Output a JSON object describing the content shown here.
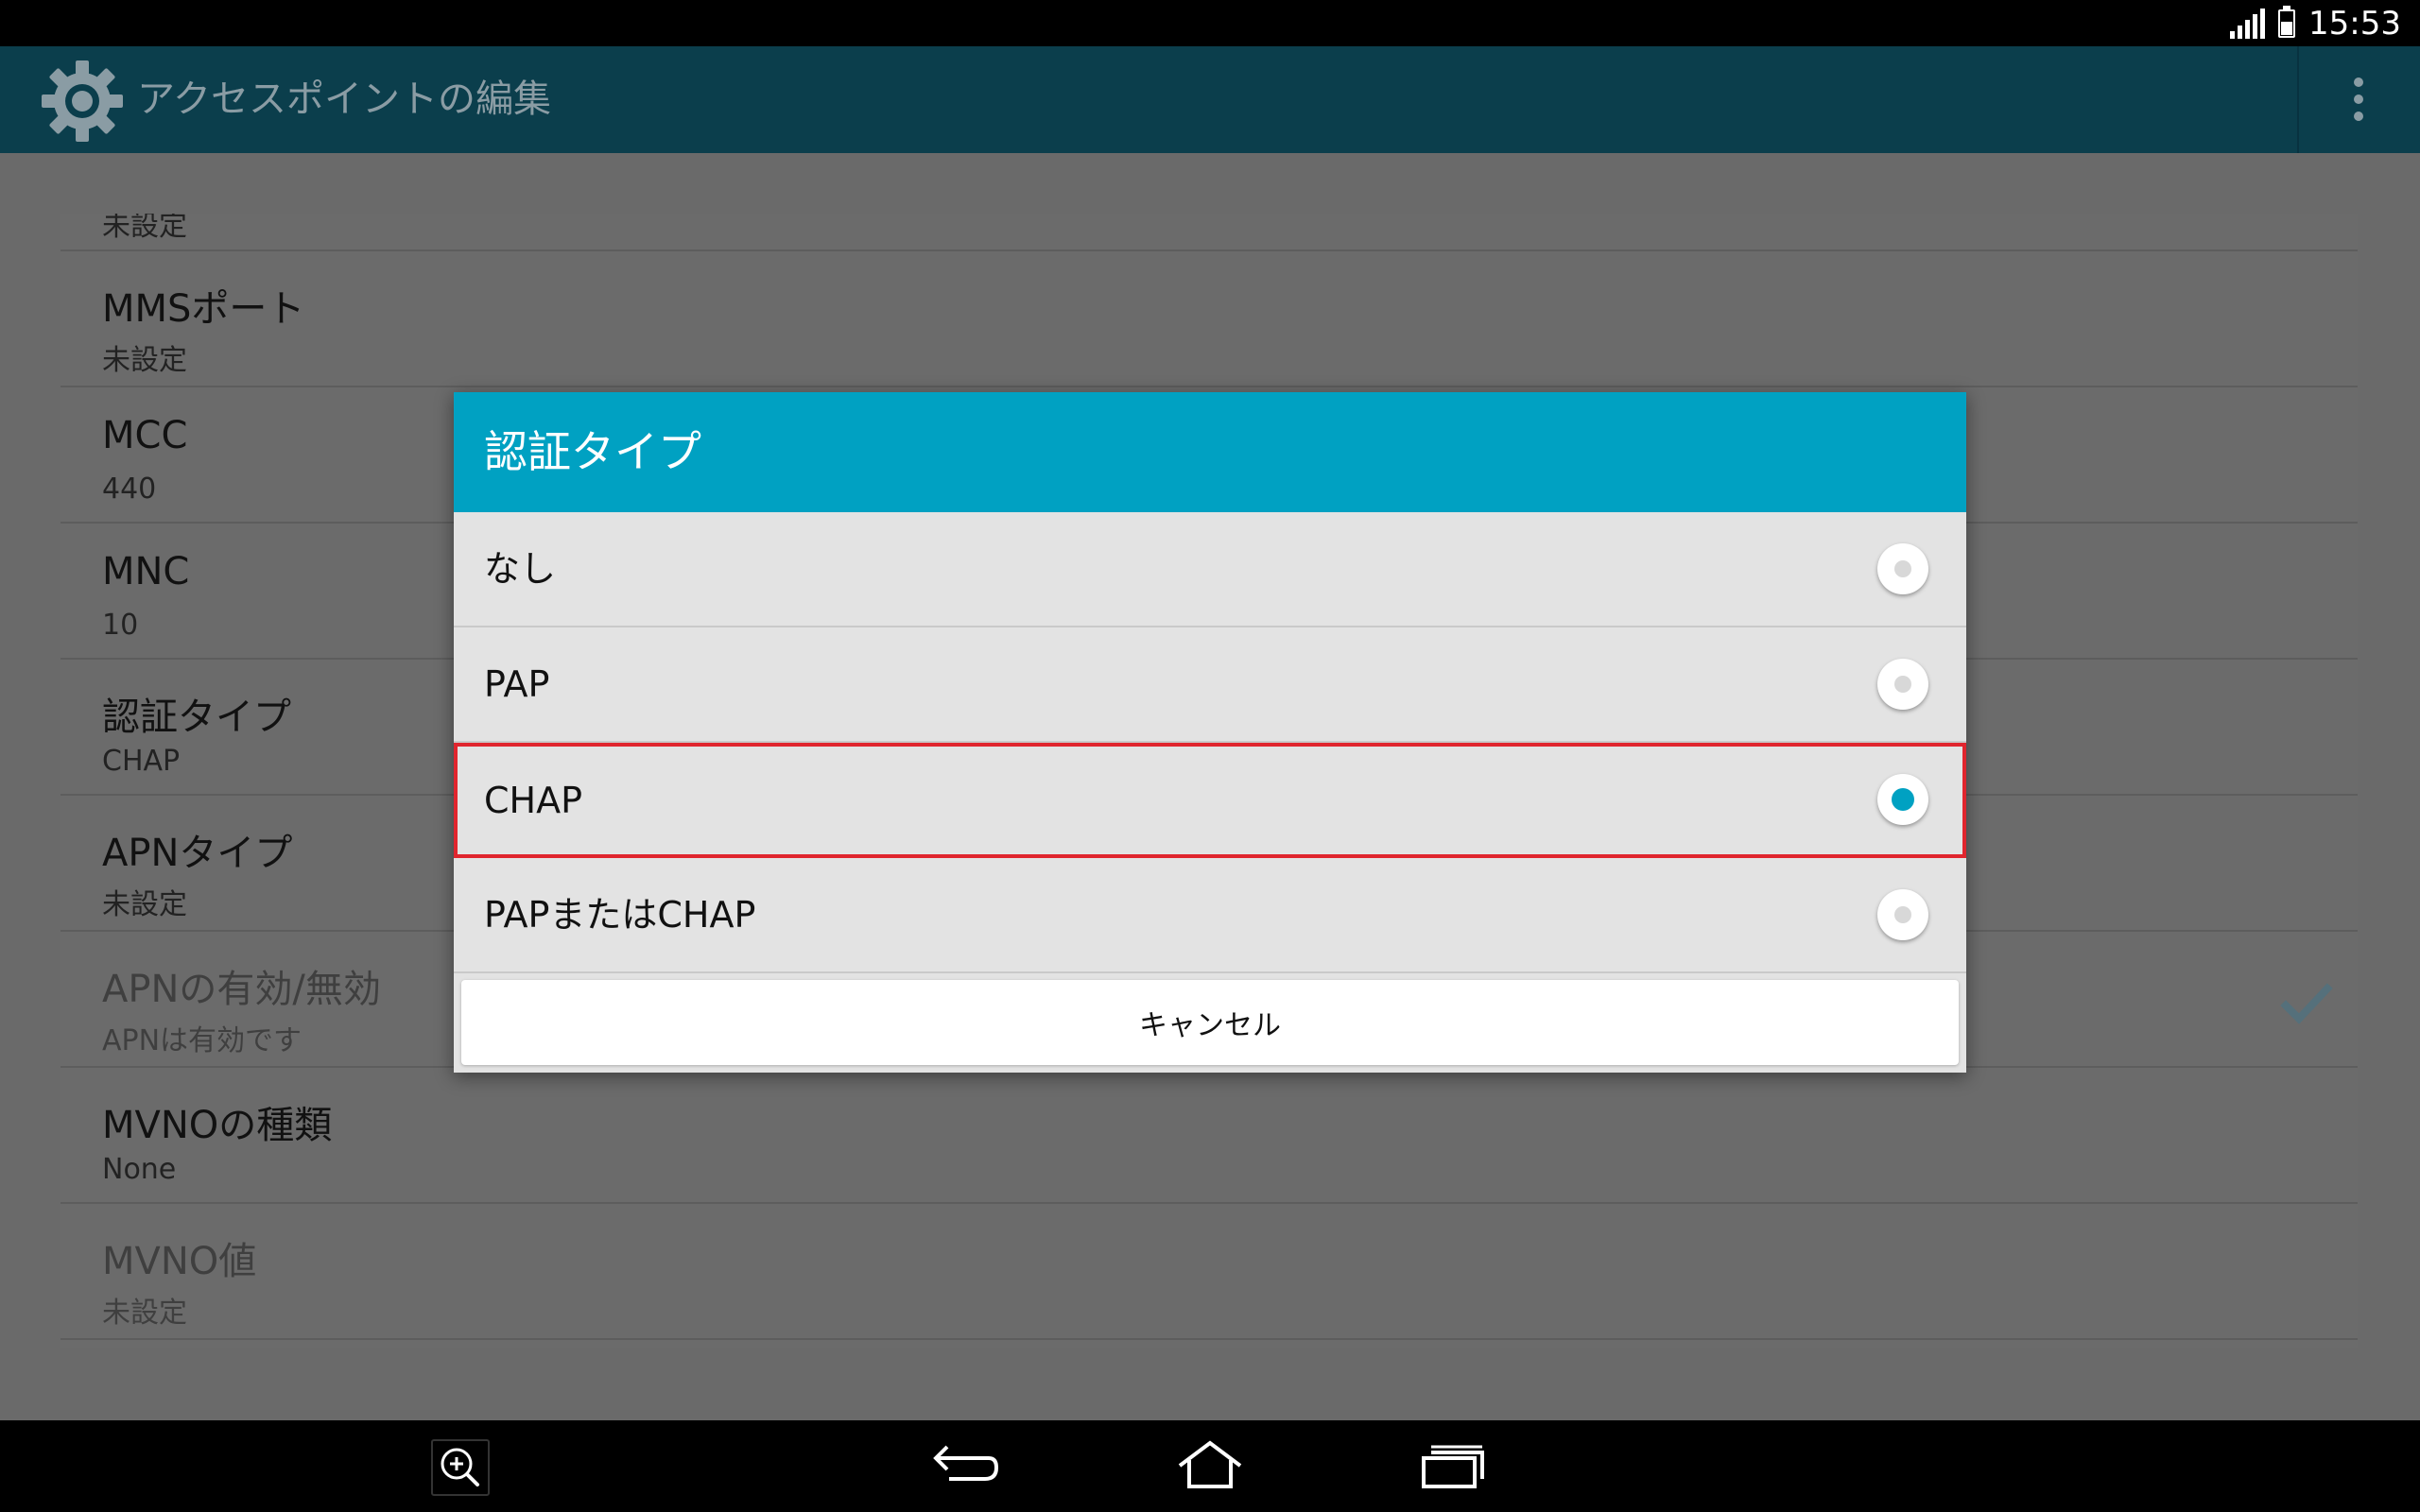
{
  "status_bar": {
    "time": "15:53",
    "signal_icon": "signal-icon",
    "battery_icon": "battery-icon"
  },
  "action_bar": {
    "title": "アクセスポイントの編集",
    "app_icon": "settings-gear-icon",
    "menu_icon": "overflow-menu-icon"
  },
  "settings_list": {
    "partial_top_value": "未設定",
    "rows": [
      {
        "title": "MMSポート",
        "value": "未設定",
        "enabled": true
      },
      {
        "title": "MCC",
        "value": "440",
        "enabled": true
      },
      {
        "title": "MNC",
        "value": "10",
        "enabled": true
      },
      {
        "title": "認証タイプ",
        "value": "CHAP",
        "enabled": true
      },
      {
        "title": "APNタイプ",
        "value": "未設定",
        "enabled": true
      },
      {
        "title": "APNの有効/無効",
        "value": "APNは有効です",
        "enabled": false,
        "checked": true
      },
      {
        "title": "MVNOの種類",
        "value": "None",
        "enabled": true
      },
      {
        "title": "MVNO値",
        "value": "未設定",
        "enabled": false
      }
    ]
  },
  "dialog": {
    "title": "認証タイプ",
    "options": [
      {
        "label": "なし",
        "selected": false
      },
      {
        "label": "PAP",
        "selected": false
      },
      {
        "label": "CHAP",
        "selected": true
      },
      {
        "label": "PAPまたはCHAP",
        "selected": false
      }
    ],
    "cancel_label": "キャンセル"
  },
  "nav_bar": {
    "buttons": [
      "zoom-icon",
      "back-icon",
      "home-icon",
      "recent-apps-icon"
    ]
  },
  "colors": {
    "accent": "#00a1c2",
    "action_bar": "#0b3e4c",
    "highlight_border": "#e0252e",
    "dim_overlay": "#6a6a6a"
  }
}
